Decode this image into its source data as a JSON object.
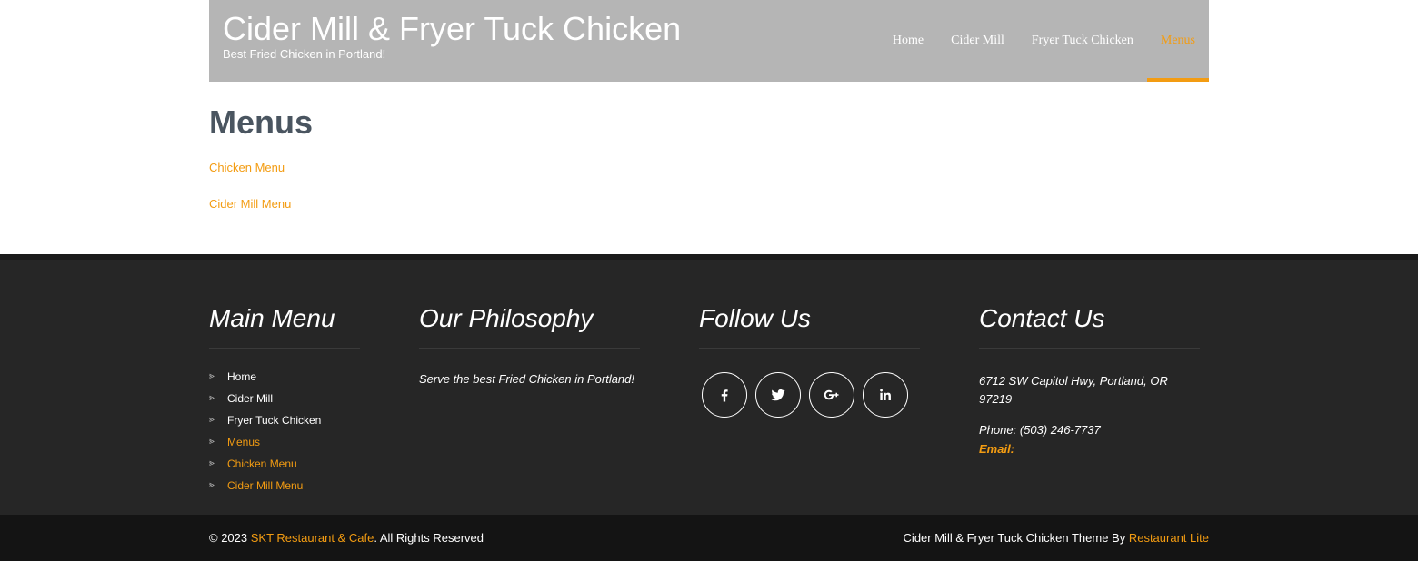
{
  "site": {
    "title": "Cider Mill & Fryer Tuck Chicken",
    "tagline": "Best Fried Chicken in Portland!"
  },
  "nav": {
    "items": [
      {
        "label": "Home"
      },
      {
        "label": "Cider Mill"
      },
      {
        "label": "Fryer Tuck Chicken"
      },
      {
        "label": "Menus",
        "active": true
      }
    ]
  },
  "page": {
    "title": "Menus",
    "links": [
      "Chicken Menu",
      "Cider Mill Menu"
    ]
  },
  "footer": {
    "main_menu": {
      "title": "Main Menu",
      "items": [
        "Home",
        "Cider Mill",
        "Fryer Tuck Chicken",
        "Menus",
        "Chicken Menu",
        "Cider Mill Menu"
      ]
    },
    "philosophy": {
      "title": "Our Philosophy",
      "text": "Serve the best Fried Chicken in Portland!"
    },
    "follow": {
      "title": "Follow Us",
      "icons": [
        "facebook-icon",
        "twitter-icon",
        "google-plus-icon",
        "linkedin-icon"
      ]
    },
    "contact": {
      "title": "Contact Us",
      "address_line1": "6712 SW Capitol Hwy, Portland, OR",
      "address_line2": "97219",
      "phone": "Phone: (503) 246-7737",
      "email_label": "Email:"
    }
  },
  "bottom": {
    "copy_prefix": "© 2023 ",
    "copy_link": "SKT Restaurant & Cafe",
    "copy_suffix": ". All Rights Reserved",
    "credit_prefix": "Cider Mill & Fryer Tuck Chicken Theme By ",
    "credit_link": "Restaurant Lite"
  },
  "colors": {
    "accent": "#f39c12",
    "header_bg": "#b5b5b5",
    "footer_bg": "#262626",
    "bottom_bg": "#141414"
  }
}
